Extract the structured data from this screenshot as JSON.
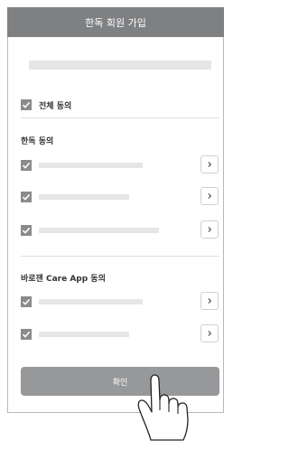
{
  "header": {
    "title": "한독 회원 가입"
  },
  "agree_all": {
    "label": "전체 동의"
  },
  "sections": [
    {
      "title": "한독 동의"
    },
    {
      "title": "바로잰 Care App 동의"
    }
  ],
  "actions": {
    "confirm_label": "확인"
  },
  "icons": {
    "checkbox": "checkbox-checked-icon",
    "chevron": "chevron-right-icon",
    "hand": "hand-pointer-icon"
  },
  "colors": {
    "header_bg": "#7f8082",
    "checkbox": "#8a8b8d",
    "button": "#97989a"
  }
}
